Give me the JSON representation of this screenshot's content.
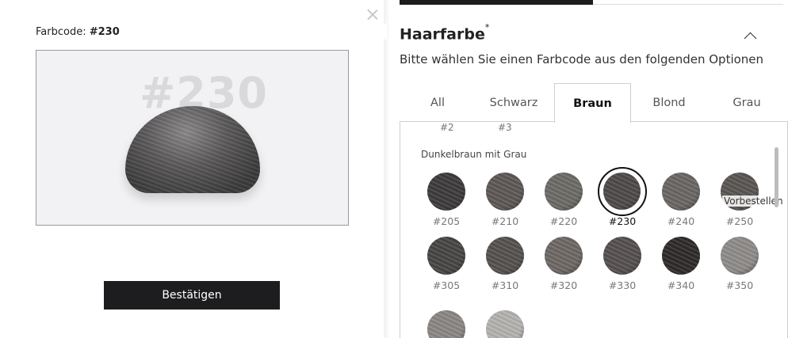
{
  "left": {
    "farbcode_label": "Farbcode:",
    "farbcode_value": "#230",
    "preview_code": "#230",
    "confirm_label": "Bestätigen"
  },
  "right": {
    "title": "Haarfarbe",
    "title_mark": "*",
    "subtitle": "Bitte wählen Sie einen Farbcode aus den folgenden Optionen",
    "tabs": [
      "All",
      "Schwarz",
      "Braun",
      "Blond",
      "Grau"
    ],
    "active_tab": "Braun",
    "previous_codes": [
      "#2",
      "#3"
    ],
    "group_label": "Dunkelbraun mit Grau",
    "tooltip": "Vorbestellen",
    "swatches": [
      {
        "code": "#205",
        "color": "#3e3b3b"
      },
      {
        "code": "#210",
        "color": "#5d5856"
      },
      {
        "code": "#220",
        "color": "#6d6b66"
      },
      {
        "code": "#230",
        "color": "#4e4a49",
        "selected": true
      },
      {
        "code": "#240",
        "color": "#6a6765"
      },
      {
        "code": "#250",
        "color": "#5a5654"
      },
      {
        "code": "#305",
        "color": "#484545"
      },
      {
        "code": "#310",
        "color": "#55524e"
      },
      {
        "code": "#320",
        "color": "#6e6865"
      },
      {
        "code": "#330",
        "color": "#565050"
      },
      {
        "code": "#340",
        "color": "#2f2b2a"
      },
      {
        "code": "#350",
        "color": "#8f8c8a"
      },
      {
        "code": "",
        "color": "#8a8785"
      },
      {
        "code": "",
        "color": "#b5b3b0"
      }
    ]
  }
}
